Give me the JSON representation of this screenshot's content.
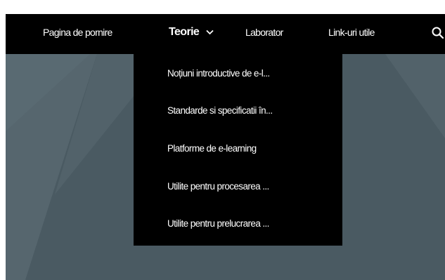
{
  "nav": {
    "items": [
      {
        "label": "Pagina de pornire"
      },
      {
        "label": "Teorie"
      },
      {
        "label": "Laborator"
      },
      {
        "label": "Link-uri utile"
      }
    ],
    "active_index": 1,
    "search_icon": "search-icon",
    "chevron_icon": "chevron-down-icon"
  },
  "dropdown": {
    "items": [
      {
        "label": "Noțiuni introductive de e-l..."
      },
      {
        "label": "Standarde si specificatii în..."
      },
      {
        "label": "Platforme de e-learning"
      },
      {
        "label": "Utilite pentru procesarea ..."
      },
      {
        "label": "Utilite pentru prelucrarea ..."
      }
    ]
  },
  "colors": {
    "navbar_bg": "#000000",
    "text": "#ffffff",
    "hero_bg": "#4a5a62",
    "page_bg": "#ffffff"
  }
}
